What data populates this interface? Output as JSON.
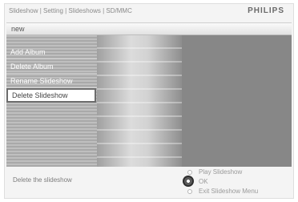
{
  "header": {
    "breadcrumb": "Slideshow | Setting | Slideshows | SD/MMC",
    "brand": "PHILIPS"
  },
  "list": {
    "header_item": "new",
    "items": [
      {
        "label": "Add Album"
      },
      {
        "label": "Delete Album"
      },
      {
        "label": "Rename Slideshow"
      },
      {
        "label": "Delete Slideshow",
        "selected": true
      }
    ]
  },
  "footer": {
    "hint": "Delete the slideshow",
    "options": {
      "play": "Play Slideshow",
      "ok": "OK",
      "exit": "Exit Slideshow Menu"
    }
  },
  "colors": {
    "menu_bg": "#b3b3b3",
    "right_panel": "#878787",
    "selected_bg": "#ffffff"
  }
}
